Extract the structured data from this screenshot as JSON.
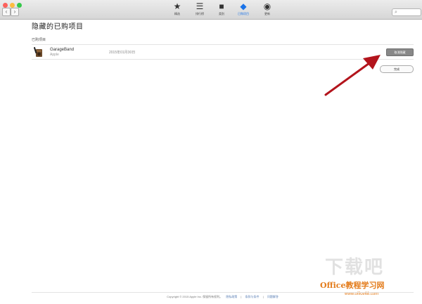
{
  "window": {
    "toolbar": [
      {
        "label": "精选",
        "icon": "star-icon",
        "glyph": "★"
      },
      {
        "label": "排行榜",
        "icon": "list-icon",
        "glyph": "☰"
      },
      {
        "label": "类别",
        "icon": "box-icon",
        "glyph": "■"
      },
      {
        "label": "已购项目",
        "icon": "tag-icon",
        "glyph": "◆",
        "active": true
      },
      {
        "label": "更新",
        "icon": "update-icon",
        "glyph": "◉"
      }
    ],
    "nav_back": "‹",
    "nav_forward": "›",
    "search": {
      "icon": "⌕",
      "placeholder": "",
      "value": ""
    }
  },
  "page": {
    "title": "隐藏的已购项目",
    "section": "已购项目",
    "items": [
      {
        "name": "GarageBand",
        "developer": "Apple",
        "date": "2015年01月30日",
        "action": "取消隐藏"
      }
    ],
    "done": "完成"
  },
  "footer": {
    "copyright": "Copyright © 2015 Apple Inc. 保留所有权利。",
    "links": [
      "隐私政策",
      "条款与条件",
      "问题解答"
    ],
    "sep": "|"
  },
  "watermark": {
    "brand": "Office教程学习网",
    "url": "www.office68.com",
    "ghost": "下载吧"
  },
  "colors": {
    "accent": "#1a73e8",
    "arrow": "#b3141c",
    "close": "#fc605b",
    "minimize": "#fdbc40",
    "zoom": "#34c84a"
  }
}
